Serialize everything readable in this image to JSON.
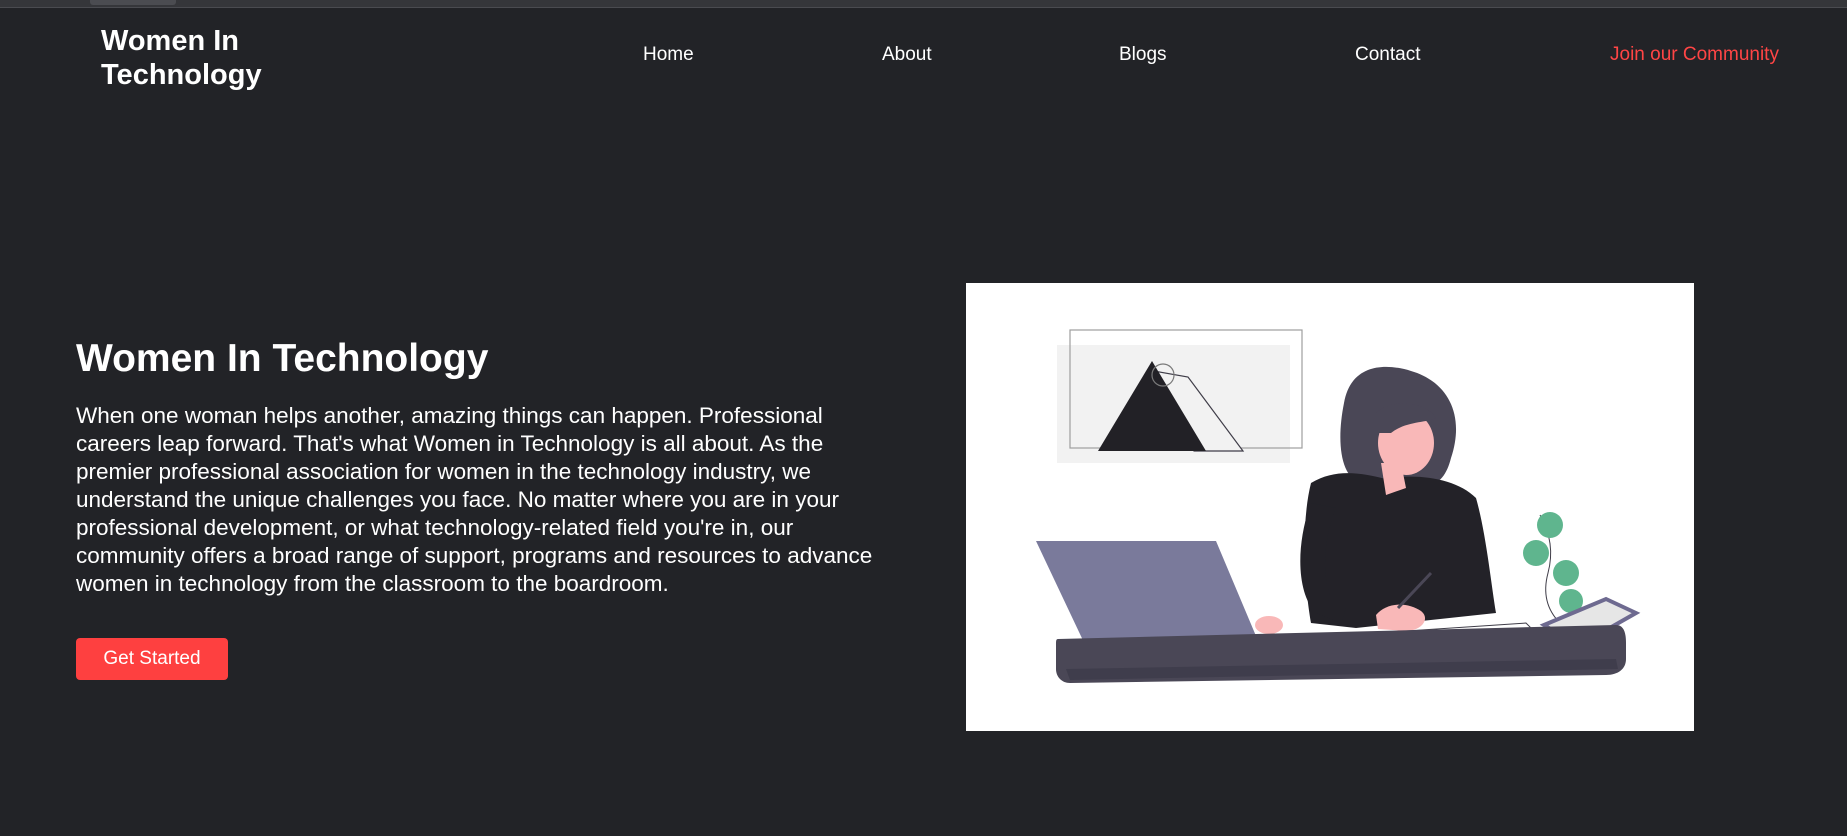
{
  "header": {
    "brand": "Women In\nTechnology",
    "nav": {
      "home": "Home",
      "about": "About",
      "blogs": "Blogs",
      "contact": "Contact",
      "join": "Join our Community"
    }
  },
  "hero": {
    "title": "Women In Technology",
    "body": "When one woman helps another, amazing things can happen. Professional careers leap forward. That's what Women in Technology is all about. As the premier professional association for women in the technology industry, we understand the unique challenges you face. No matter where you are in your professional development, or what technology-related field you're in, our community offers a broad range of support, programs and resources to advance women in technology from the classroom to the boardroom.",
    "button_label": "Get Started"
  },
  "colors": {
    "background": "#222327",
    "accent": "#fe4040",
    "text": "#ffffff",
    "illustration_hair": "#4a4756",
    "illustration_laptop": "#7a7a9b",
    "illustration_plant": "#5fb58e"
  },
  "icons": {
    "illustration": "woman-at-laptop-illustration"
  }
}
